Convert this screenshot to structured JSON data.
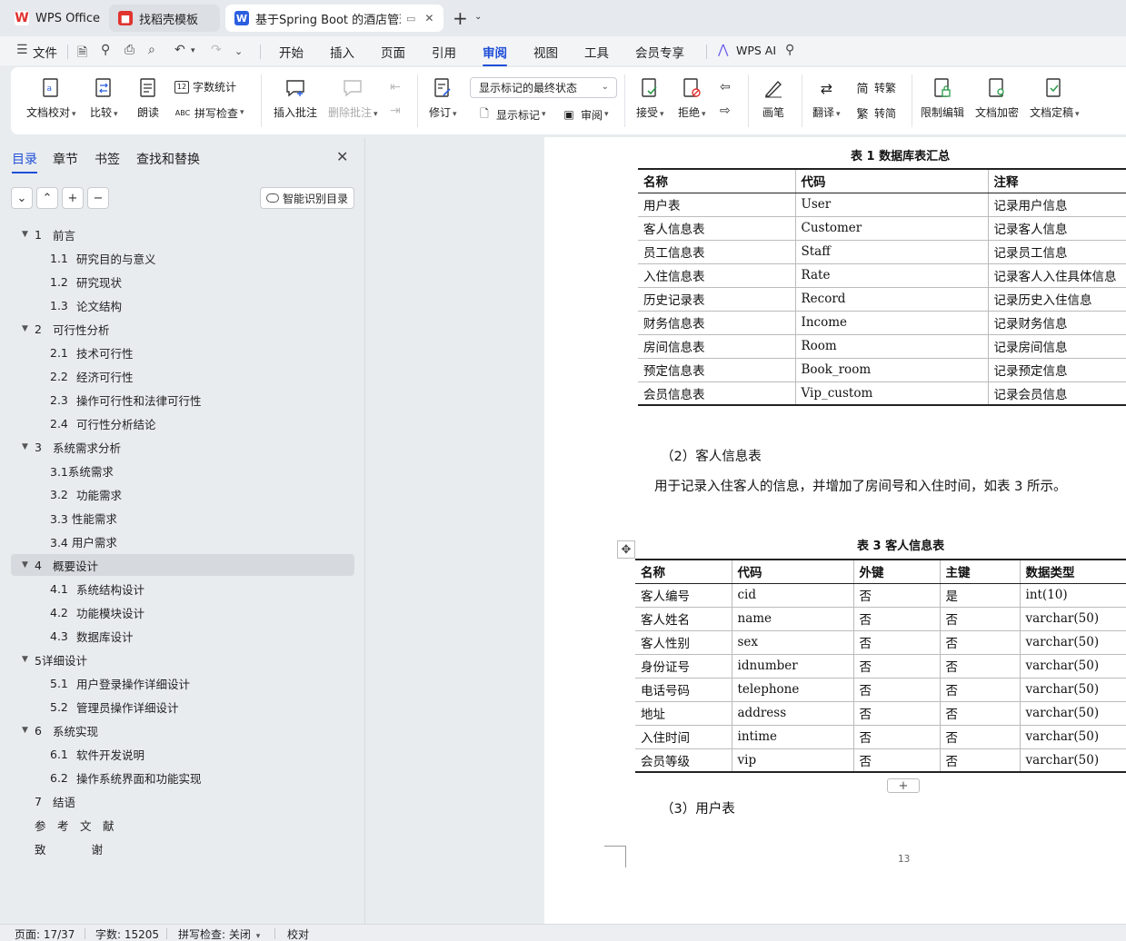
{
  "tabs": [
    {
      "label": "WPS Office",
      "icon": "wps-logo-icon"
    },
    {
      "label": "找稻壳模板",
      "icon": "docer-logo-icon"
    },
    {
      "label": "基于Spring Boot 的酒店管理",
      "icon": "writer-doc-icon"
    }
  ],
  "menu": {
    "file": "文件",
    "items": [
      "开始",
      "插入",
      "页面",
      "引用",
      "审阅",
      "视图",
      "工具",
      "会员专享"
    ],
    "active": "审阅",
    "ai": "WPS AI"
  },
  "ribbon": {
    "doc_check": "文档校对",
    "compare": "比较",
    "read_aloud": "朗读",
    "word_count": "字数统计",
    "spell_check": "拼写检查",
    "insert_comment": "插入批注",
    "delete_comment": "删除批注",
    "revise": "修订",
    "markup_state": "显示标记的最终状态",
    "show_markup": "显示标记",
    "review": "审阅",
    "accept": "接受",
    "reject": "拒绝",
    "pen": "画笔",
    "translate": "翻译",
    "to_traditional": "转繁",
    "to_simplified": "转简",
    "trad_char": "简",
    "simp_char": "繁",
    "restrict_edit": "限制编辑",
    "encrypt": "文档加密",
    "finalize": "文档定稿"
  },
  "panel": {
    "tabs": [
      "目录",
      "章节",
      "书签",
      "查找和替换"
    ],
    "smart_toc": "智能识别目录",
    "toc": [
      {
        "num": "1",
        "text": "前言",
        "level": 1,
        "collapsible": true
      },
      {
        "num": "1.1",
        "text": "研究目的与意义",
        "level": 2
      },
      {
        "num": "1.2",
        "text": "研究现状",
        "level": 2
      },
      {
        "num": "1.3",
        "text": "论文结构",
        "level": 2
      },
      {
        "num": "2",
        "text": "可行性分析",
        "level": 1,
        "collapsible": true
      },
      {
        "num": "2.1",
        "text": "技术可行性",
        "level": 2
      },
      {
        "num": "2.2",
        "text": "经济可行性",
        "level": 2
      },
      {
        "num": "2.3",
        "text": "操作可行性和法律可行性",
        "level": 2
      },
      {
        "num": "2.4",
        "text": "可行性分析结论",
        "level": 2
      },
      {
        "num": "3",
        "text": "系统需求分析",
        "level": 1,
        "collapsible": true
      },
      {
        "num": "",
        "text": "3.1系统需求",
        "level": 2
      },
      {
        "num": "3.2",
        "text": "功能需求",
        "level": 2
      },
      {
        "num": "",
        "text": "3.3 性能需求",
        "level": 2
      },
      {
        "num": "",
        "text": "3.4 用户需求",
        "level": 2
      },
      {
        "num": "4",
        "text": "概要设计",
        "level": 1,
        "collapsible": true,
        "selected": true
      },
      {
        "num": "4.1",
        "text": "系统结构设计",
        "level": 2
      },
      {
        "num": "4.2",
        "text": "功能模块设计",
        "level": 2
      },
      {
        "num": "4.3",
        "text": "数据库设计",
        "level": 2
      },
      {
        "num": "",
        "text": "5详细设计",
        "level": 1,
        "collapsible": true
      },
      {
        "num": "5.1",
        "text": "用户登录操作详细设计",
        "level": 2
      },
      {
        "num": "5.2",
        "text": "管理员操作详细设计",
        "level": 2
      },
      {
        "num": "6",
        "text": "系统实现",
        "level": 1,
        "collapsible": true
      },
      {
        "num": "6.1",
        "text": "软件开发说明",
        "level": 2
      },
      {
        "num": "6.2",
        "text": "操作系统界面和功能实现",
        "level": 2
      },
      {
        "num": "7",
        "text": "结语",
        "level": 1
      },
      {
        "num": "",
        "text": "参　考　文　献",
        "level": 1
      },
      {
        "num": "",
        "text": "致　　　　谢",
        "level": 1
      }
    ]
  },
  "doc": {
    "table1": {
      "caption": "表 1  数据库表汇总",
      "headers": [
        "名称",
        "代码",
        "注释"
      ],
      "rows": [
        [
          "用户表",
          "User",
          "记录用户信息"
        ],
        [
          "客人信息表",
          "Customer",
          "记录客人信息"
        ],
        [
          "员工信息表",
          "Staff",
          "记录员工信息"
        ],
        [
          "入住信息表",
          "Rate",
          "记录客人入住具体信息"
        ],
        [
          "历史记录表",
          "Record",
          "记录历史入住信息"
        ],
        [
          "财务信息表",
          "Income",
          "记录财务信息"
        ],
        [
          "房间信息表",
          "Room",
          "记录房间信息"
        ],
        [
          "预定信息表",
          "Book_room",
          "记录预定信息"
        ],
        [
          "会员信息表",
          "Vip_custom",
          "记录会员信息"
        ]
      ]
    },
    "heading2": "（2）客人信息表",
    "para2": "用于记录入住客人的信息，并增加了房间号和入住时间，如表 3 所示。",
    "table3": {
      "caption": "表 3  客人信息表",
      "headers": [
        "名称",
        "代码",
        "外键",
        "主键",
        "数据类型"
      ],
      "rows": [
        [
          "客人编号",
          "cid",
          "否",
          "是",
          "int(10)"
        ],
        [
          "客人姓名",
          "name",
          "否",
          "否",
          "varchar(50)"
        ],
        [
          "客人性别",
          "sex",
          "否",
          "否",
          "varchar(50)"
        ],
        [
          "身份证号",
          "idnumber",
          "否",
          "否",
          "varchar(50)"
        ],
        [
          "电话号码",
          "telephone",
          "否",
          "否",
          "varchar(50)"
        ],
        [
          "地址",
          "address",
          "否",
          "否",
          "varchar(50)"
        ],
        [
          "入住时间",
          "intime",
          "否",
          "否",
          "varchar(50)"
        ],
        [
          "会员等级",
          "vip",
          "否",
          "否",
          "varchar(50)"
        ]
      ]
    },
    "heading3": "（3）用户表",
    "page_number": "13"
  },
  "status": {
    "page": "页面: 17/37",
    "words": "字数: 15205",
    "spell": "拼写检查: 关闭",
    "proof": "校对"
  },
  "colors": {
    "accent": "#1f4fd8",
    "wps_red": "#e0322e",
    "writer_blue": "#2b5fe0"
  }
}
